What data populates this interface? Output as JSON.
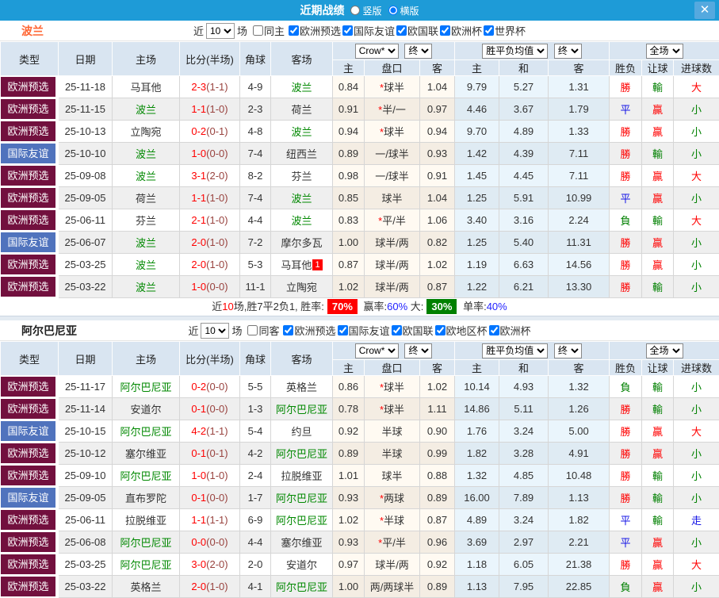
{
  "titlebar": {
    "title": "近期战绩",
    "layout_options": [
      {
        "label": "竖版",
        "selected": false
      },
      {
        "label": "横版",
        "selected": true
      }
    ],
    "close": "✕"
  },
  "filter_text": {
    "near": "近",
    "games": "场"
  },
  "columns": {
    "base": [
      "类型",
      "日期",
      "主场",
      "比分(半场)",
      "角球",
      "客场"
    ],
    "odds_select": "Crow*",
    "odds_final_select": "终",
    "odds_cols": [
      "主",
      "盘口",
      "客"
    ],
    "avg_select": "胜平负均值",
    "avg_final_select": "终",
    "avg_cols": [
      "主",
      "和",
      "客"
    ],
    "result_select": "全场",
    "result_cols": [
      "胜负",
      "让球",
      "进球数"
    ]
  },
  "colors": {
    "header_bar": "#1E9BD7",
    "euro": "#72103E",
    "friendly": "#5073BD",
    "win_red": "#FF0000",
    "draw_blue": "#1414E6",
    "loss_green": "#008000"
  },
  "teams": [
    {
      "name": "波兰",
      "name_color": "#FF6633",
      "filters": {
        "count": "10",
        "same_label": "同主",
        "same_checked": false,
        "leagues": [
          {
            "label": "欧洲预选",
            "checked": true
          },
          {
            "label": "国际友谊",
            "checked": true
          },
          {
            "label": "欧国联",
            "checked": true
          },
          {
            "label": "欧洲杯",
            "checked": true
          },
          {
            "label": "世界杯",
            "checked": true
          }
        ]
      },
      "rows": [
        {
          "league": "欧洲预选",
          "league_type": "euro",
          "date": "25-11-18",
          "home": "马耳他",
          "home_is_team": false,
          "score": "2-3",
          "half": "(1-1)",
          "corner": "4-9",
          "away": "波兰",
          "away_is_team": true,
          "away_badge": "",
          "odds_home": "0.84",
          "handicap": "*球半",
          "odds_away": "1.04",
          "avg_home": "9.79",
          "avg_draw": "5.27",
          "avg_away": "1.31",
          "result": [
            "勝",
            "r"
          ],
          "asian": [
            "輸",
            "g"
          ],
          "goals": [
            "大",
            "r"
          ]
        },
        {
          "league": "欧洲预选",
          "league_type": "euro",
          "date": "25-11-15",
          "home": "波兰",
          "home_is_team": true,
          "score": "1-1",
          "half": "(1-0)",
          "corner": "2-3",
          "away": "荷兰",
          "away_is_team": false,
          "away_badge": "",
          "odds_home": "0.91",
          "handicap": "*半/一",
          "odds_away": "0.97",
          "avg_home": "4.46",
          "avg_draw": "3.67",
          "avg_away": "1.79",
          "result": [
            "平",
            "b"
          ],
          "asian": [
            "贏",
            "r"
          ],
          "goals": [
            "小",
            "g"
          ]
        },
        {
          "league": "欧洲预选",
          "league_type": "euro",
          "date": "25-10-13",
          "home": "立陶宛",
          "home_is_team": false,
          "score": "0-2",
          "half": "(0-1)",
          "corner": "4-8",
          "away": "波兰",
          "away_is_team": true,
          "away_badge": "",
          "odds_home": "0.94",
          "handicap": "*球半",
          "odds_away": "0.94",
          "avg_home": "9.70",
          "avg_draw": "4.89",
          "avg_away": "1.33",
          "result": [
            "勝",
            "r"
          ],
          "asian": [
            "贏",
            "r"
          ],
          "goals": [
            "小",
            "g"
          ]
        },
        {
          "league": "国际友谊",
          "league_type": "friendly",
          "date": "25-10-10",
          "home": "波兰",
          "home_is_team": true,
          "score": "1-0",
          "half": "(0-0)",
          "corner": "7-4",
          "away": "纽西兰",
          "away_is_team": false,
          "away_badge": "",
          "odds_home": "0.89",
          "handicap": "一/球半",
          "odds_away": "0.93",
          "avg_home": "1.42",
          "avg_draw": "4.39",
          "avg_away": "7.11",
          "result": [
            "勝",
            "r"
          ],
          "asian": [
            "輸",
            "g"
          ],
          "goals": [
            "小",
            "g"
          ]
        },
        {
          "league": "欧洲预选",
          "league_type": "euro",
          "date": "25-09-08",
          "home": "波兰",
          "home_is_team": true,
          "score": "3-1",
          "half": "(2-0)",
          "corner": "8-2",
          "away": "芬兰",
          "away_is_team": false,
          "away_badge": "",
          "odds_home": "0.98",
          "handicap": "一/球半",
          "odds_away": "0.91",
          "avg_home": "1.45",
          "avg_draw": "4.45",
          "avg_away": "7.11",
          "result": [
            "勝",
            "r"
          ],
          "asian": [
            "贏",
            "r"
          ],
          "goals": [
            "大",
            "r"
          ]
        },
        {
          "league": "欧洲预选",
          "league_type": "euro",
          "date": "25-09-05",
          "home": "荷兰",
          "home_is_team": false,
          "score": "1-1",
          "half": "(1-0)",
          "corner": "7-4",
          "away": "波兰",
          "away_is_team": true,
          "away_badge": "",
          "odds_home": "0.85",
          "handicap": "球半",
          "odds_away": "1.04",
          "avg_home": "1.25",
          "avg_draw": "5.91",
          "avg_away": "10.99",
          "result": [
            "平",
            "b"
          ],
          "asian": [
            "贏",
            "r"
          ],
          "goals": [
            "小",
            "g"
          ]
        },
        {
          "league": "欧洲预选",
          "league_type": "euro",
          "date": "25-06-11",
          "home": "芬兰",
          "home_is_team": false,
          "score": "2-1",
          "half": "(1-0)",
          "corner": "4-4",
          "away": "波兰",
          "away_is_team": true,
          "away_badge": "",
          "odds_home": "0.83",
          "handicap": "*平/半",
          "odds_away": "1.06",
          "avg_home": "3.40",
          "avg_draw": "3.16",
          "avg_away": "2.24",
          "result": [
            "負",
            "g"
          ],
          "asian": [
            "輸",
            "g"
          ],
          "goals": [
            "大",
            "r"
          ]
        },
        {
          "league": "国际友谊",
          "league_type": "friendly",
          "date": "25-06-07",
          "home": "波兰",
          "home_is_team": true,
          "score": "2-0",
          "half": "(1-0)",
          "corner": "7-2",
          "away": "摩尔多瓦",
          "away_is_team": false,
          "away_badge": "",
          "odds_home": "1.00",
          "handicap": "球半/两",
          "odds_away": "0.82",
          "avg_home": "1.25",
          "avg_draw": "5.40",
          "avg_away": "11.31",
          "result": [
            "勝",
            "r"
          ],
          "asian": [
            "贏",
            "r"
          ],
          "goals": [
            "小",
            "g"
          ]
        },
        {
          "league": "欧洲预选",
          "league_type": "euro",
          "date": "25-03-25",
          "home": "波兰",
          "home_is_team": true,
          "score": "2-0",
          "half": "(1-0)",
          "corner": "5-3",
          "away": "马耳他",
          "away_is_team": false,
          "away_badge": "1",
          "odds_home": "0.87",
          "handicap": "球半/两",
          "odds_away": "1.02",
          "avg_home": "1.19",
          "avg_draw": "6.63",
          "avg_away": "14.56",
          "result": [
            "勝",
            "r"
          ],
          "asian": [
            "贏",
            "r"
          ],
          "goals": [
            "小",
            "g"
          ]
        },
        {
          "league": "欧洲预选",
          "league_type": "euro",
          "date": "25-03-22",
          "home": "波兰",
          "home_is_team": true,
          "score": "1-0",
          "half": "(0-0)",
          "corner": "11-1",
          "away": "立陶宛",
          "away_is_team": false,
          "away_badge": "",
          "odds_home": "1.02",
          "handicap": "球半/两",
          "odds_away": "0.87",
          "avg_home": "1.22",
          "avg_draw": "6.21",
          "avg_away": "13.30",
          "result": [
            "勝",
            "r"
          ],
          "asian": [
            "輸",
            "g"
          ],
          "goals": [
            "小",
            "g"
          ]
        }
      ],
      "summary": [
        {
          "text": "近",
          "style": "plain"
        },
        {
          "text": "10",
          "style": "red"
        },
        {
          "text": "场,胜7平2负1, 胜率:",
          "style": "plain"
        },
        {
          "text": "70%",
          "style": "badge-red"
        },
        {
          "text": " 赢率:",
          "style": "plain"
        },
        {
          "text": "60%",
          "style": "blue"
        },
        {
          "text": " 大:",
          "style": "plain"
        },
        {
          "text": "30%",
          "style": "badge-green"
        },
        {
          "text": " 单率:",
          "style": "plain"
        },
        {
          "text": "40%",
          "style": "blue"
        }
      ]
    },
    {
      "name": "阿尔巴尼亚",
      "name_color": "#222222",
      "filters": {
        "count": "10",
        "same_label": "同客",
        "same_checked": false,
        "leagues": [
          {
            "label": "欧洲预选",
            "checked": true
          },
          {
            "label": "国际友谊",
            "checked": true
          },
          {
            "label": "欧国联",
            "checked": true
          },
          {
            "label": "欧地区杯",
            "checked": true
          },
          {
            "label": "欧洲杯",
            "checked": true
          }
        ]
      },
      "rows": [
        {
          "league": "欧洲预选",
          "league_type": "euro",
          "date": "25-11-17",
          "home": "阿尔巴尼亚",
          "home_is_team": true,
          "score": "0-2",
          "half": "(0-0)",
          "corner": "5-5",
          "away": "英格兰",
          "away_is_team": false,
          "away_badge": "",
          "odds_home": "0.86",
          "handicap": "*球半",
          "odds_away": "1.02",
          "avg_home": "10.14",
          "avg_draw": "4.93",
          "avg_away": "1.32",
          "result": [
            "負",
            "g"
          ],
          "asian": [
            "輸",
            "g"
          ],
          "goals": [
            "小",
            "g"
          ]
        },
        {
          "league": "欧洲预选",
          "league_type": "euro",
          "date": "25-11-14",
          "home": "安道尔",
          "home_is_team": false,
          "score": "0-1",
          "half": "(0-0)",
          "corner": "1-3",
          "away": "阿尔巴尼亚",
          "away_is_team": true,
          "away_badge": "",
          "odds_home": "0.78",
          "handicap": "*球半",
          "odds_away": "1.11",
          "avg_home": "14.86",
          "avg_draw": "5.11",
          "avg_away": "1.26",
          "result": [
            "勝",
            "r"
          ],
          "asian": [
            "輸",
            "g"
          ],
          "goals": [
            "小",
            "g"
          ]
        },
        {
          "league": "国际友谊",
          "league_type": "friendly",
          "date": "25-10-15",
          "home": "阿尔巴尼亚",
          "home_is_team": true,
          "score": "4-2",
          "half": "(1-1)",
          "corner": "5-4",
          "away": "约旦",
          "away_is_team": false,
          "away_badge": "",
          "odds_home": "0.92",
          "handicap": "半球",
          "odds_away": "0.90",
          "avg_home": "1.76",
          "avg_draw": "3.24",
          "avg_away": "5.00",
          "result": [
            "勝",
            "r"
          ],
          "asian": [
            "贏",
            "r"
          ],
          "goals": [
            "大",
            "r"
          ]
        },
        {
          "league": "欧洲预选",
          "league_type": "euro",
          "date": "25-10-12",
          "home": "塞尔维亚",
          "home_is_team": false,
          "score": "0-1",
          "half": "(0-1)",
          "corner": "4-2",
          "away": "阿尔巴尼亚",
          "away_is_team": true,
          "away_badge": "",
          "odds_home": "0.89",
          "handicap": "半球",
          "odds_away": "0.99",
          "avg_home": "1.82",
          "avg_draw": "3.28",
          "avg_away": "4.91",
          "result": [
            "勝",
            "r"
          ],
          "asian": [
            "贏",
            "r"
          ],
          "goals": [
            "小",
            "g"
          ]
        },
        {
          "league": "欧洲预选",
          "league_type": "euro",
          "date": "25-09-10",
          "home": "阿尔巴尼亚",
          "home_is_team": true,
          "score": "1-0",
          "half": "(1-0)",
          "corner": "2-4",
          "away": "拉脱维亚",
          "away_is_team": false,
          "away_badge": "",
          "odds_home": "1.01",
          "handicap": "球半",
          "odds_away": "0.88",
          "avg_home": "1.32",
          "avg_draw": "4.85",
          "avg_away": "10.48",
          "result": [
            "勝",
            "r"
          ],
          "asian": [
            "輸",
            "g"
          ],
          "goals": [
            "小",
            "g"
          ]
        },
        {
          "league": "国际友谊",
          "league_type": "friendly",
          "date": "25-09-05",
          "home": "直布罗陀",
          "home_is_team": false,
          "score": "0-1",
          "half": "(0-0)",
          "corner": "1-7",
          "away": "阿尔巴尼亚",
          "away_is_team": true,
          "away_badge": "",
          "odds_home": "0.93",
          "handicap": "*两球",
          "odds_away": "0.89",
          "avg_home": "16.00",
          "avg_draw": "7.89",
          "avg_away": "1.13",
          "result": [
            "勝",
            "r"
          ],
          "asian": [
            "輸",
            "g"
          ],
          "goals": [
            "小",
            "g"
          ]
        },
        {
          "league": "欧洲预选",
          "league_type": "euro",
          "date": "25-06-11",
          "home": "拉脱维亚",
          "home_is_team": false,
          "score": "1-1",
          "half": "(1-1)",
          "corner": "6-9",
          "away": "阿尔巴尼亚",
          "away_is_team": true,
          "away_badge": "",
          "odds_home": "1.02",
          "handicap": "*半球",
          "odds_away": "0.87",
          "avg_home": "4.89",
          "avg_draw": "3.24",
          "avg_away": "1.82",
          "result": [
            "平",
            "b"
          ],
          "asian": [
            "輸",
            "g"
          ],
          "goals": [
            "走",
            "b"
          ]
        },
        {
          "league": "欧洲预选",
          "league_type": "euro",
          "date": "25-06-08",
          "home": "阿尔巴尼亚",
          "home_is_team": true,
          "score": "0-0",
          "half": "(0-0)",
          "corner": "4-4",
          "away": "塞尔维亚",
          "away_is_team": false,
          "away_badge": "",
          "odds_home": "0.93",
          "handicap": "*平/半",
          "odds_away": "0.96",
          "avg_home": "3.69",
          "avg_draw": "2.97",
          "avg_away": "2.21",
          "result": [
            "平",
            "b"
          ],
          "asian": [
            "贏",
            "r"
          ],
          "goals": [
            "小",
            "g"
          ]
        },
        {
          "league": "欧洲预选",
          "league_type": "euro",
          "date": "25-03-25",
          "home": "阿尔巴尼亚",
          "home_is_team": true,
          "score": "3-0",
          "half": "(2-0)",
          "corner": "2-0",
          "away": "安道尔",
          "away_is_team": false,
          "away_badge": "",
          "odds_home": "0.97",
          "handicap": "球半/两",
          "odds_away": "0.92",
          "avg_home": "1.18",
          "avg_draw": "6.05",
          "avg_away": "21.38",
          "result": [
            "勝",
            "r"
          ],
          "asian": [
            "贏",
            "r"
          ],
          "goals": [
            "大",
            "r"
          ]
        },
        {
          "league": "欧洲预选",
          "league_type": "euro",
          "date": "25-03-22",
          "home": "英格兰",
          "home_is_team": false,
          "score": "2-0",
          "half": "(1-0)",
          "corner": "4-1",
          "away": "阿尔巴尼亚",
          "away_is_team": true,
          "away_badge": "",
          "odds_home": "1.00",
          "handicap": "两/两球半",
          "odds_away": "0.89",
          "avg_home": "1.13",
          "avg_draw": "7.95",
          "avg_away": "22.85",
          "result": [
            "負",
            "g"
          ],
          "asian": [
            "贏",
            "r"
          ],
          "goals": [
            "小",
            "g"
          ]
        }
      ],
      "summary": []
    }
  ]
}
